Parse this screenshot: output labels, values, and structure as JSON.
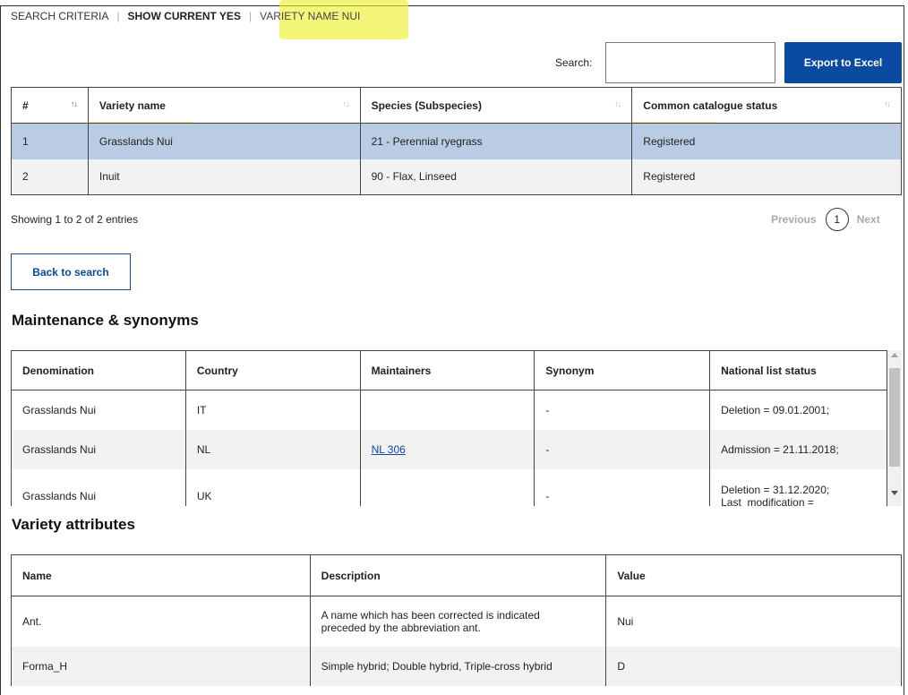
{
  "criteria": {
    "label": "SEARCH CRITERIA",
    "separator": "|",
    "item1": "SHOW CURRENT YES",
    "item2": "VARIETY NAME NUI"
  },
  "search": {
    "label": "Search:",
    "value": ""
  },
  "export_label": "Export to Excel",
  "results": {
    "columns": [
      "#",
      "Variety name",
      "Species (Subspecies)",
      "Common catalogue status"
    ],
    "sort_icon": "↑↓",
    "rows": [
      {
        "num": "1",
        "name": "Grasslands Nui",
        "species": "21 - Perennial ryegrass",
        "status": "Registered"
      },
      {
        "num": "2",
        "name": "Inuit",
        "species": "90 - Flax, Linseed",
        "status": "Registered"
      }
    ]
  },
  "showing": "Showing 1 to 2 of 2 entries",
  "pager": {
    "previous": "Previous",
    "page": "1",
    "next": "Next"
  },
  "back_label": "Back to search",
  "maintenance": {
    "title": "Maintenance & synonyms",
    "columns": [
      "Denomination",
      "Country",
      "Maintainers",
      "Synonym",
      "National list status"
    ],
    "rows": [
      {
        "denomination": "Grasslands Nui",
        "country": "IT",
        "maintainer": "",
        "synonym": "-",
        "status1": "Deletion = 09.01.2001;",
        "status2": ""
      },
      {
        "denomination": "Grasslands Nui",
        "country": "NL",
        "maintainer": "NL 306",
        "synonym": "-",
        "status1": "Admission = 21.11.2018;",
        "status2": ""
      },
      {
        "denomination": "Grasslands Nui",
        "country": "UK",
        "maintainer": "",
        "synonym": "-",
        "status1": "Deletion = 31.12.2020;",
        "status2": "Last_modification ="
      }
    ]
  },
  "attributes": {
    "title": "Variety attributes",
    "columns": [
      "Name",
      "Description",
      "Value"
    ],
    "rows": [
      {
        "name": "Ant.",
        "desc1": "A name which has been corrected is indicated",
        "desc2": "preceded by the abbreviation ant.",
        "value": "Nui"
      },
      {
        "name": "Forma_H",
        "desc1": "Simple hybrid; Double hybrid, Triple-cross hybrid",
        "desc2": "",
        "value": "D"
      }
    ]
  },
  "colors": {
    "accent": "#0a4aa0",
    "selected_row": "#b9cce4",
    "highlight": "#eef028"
  }
}
